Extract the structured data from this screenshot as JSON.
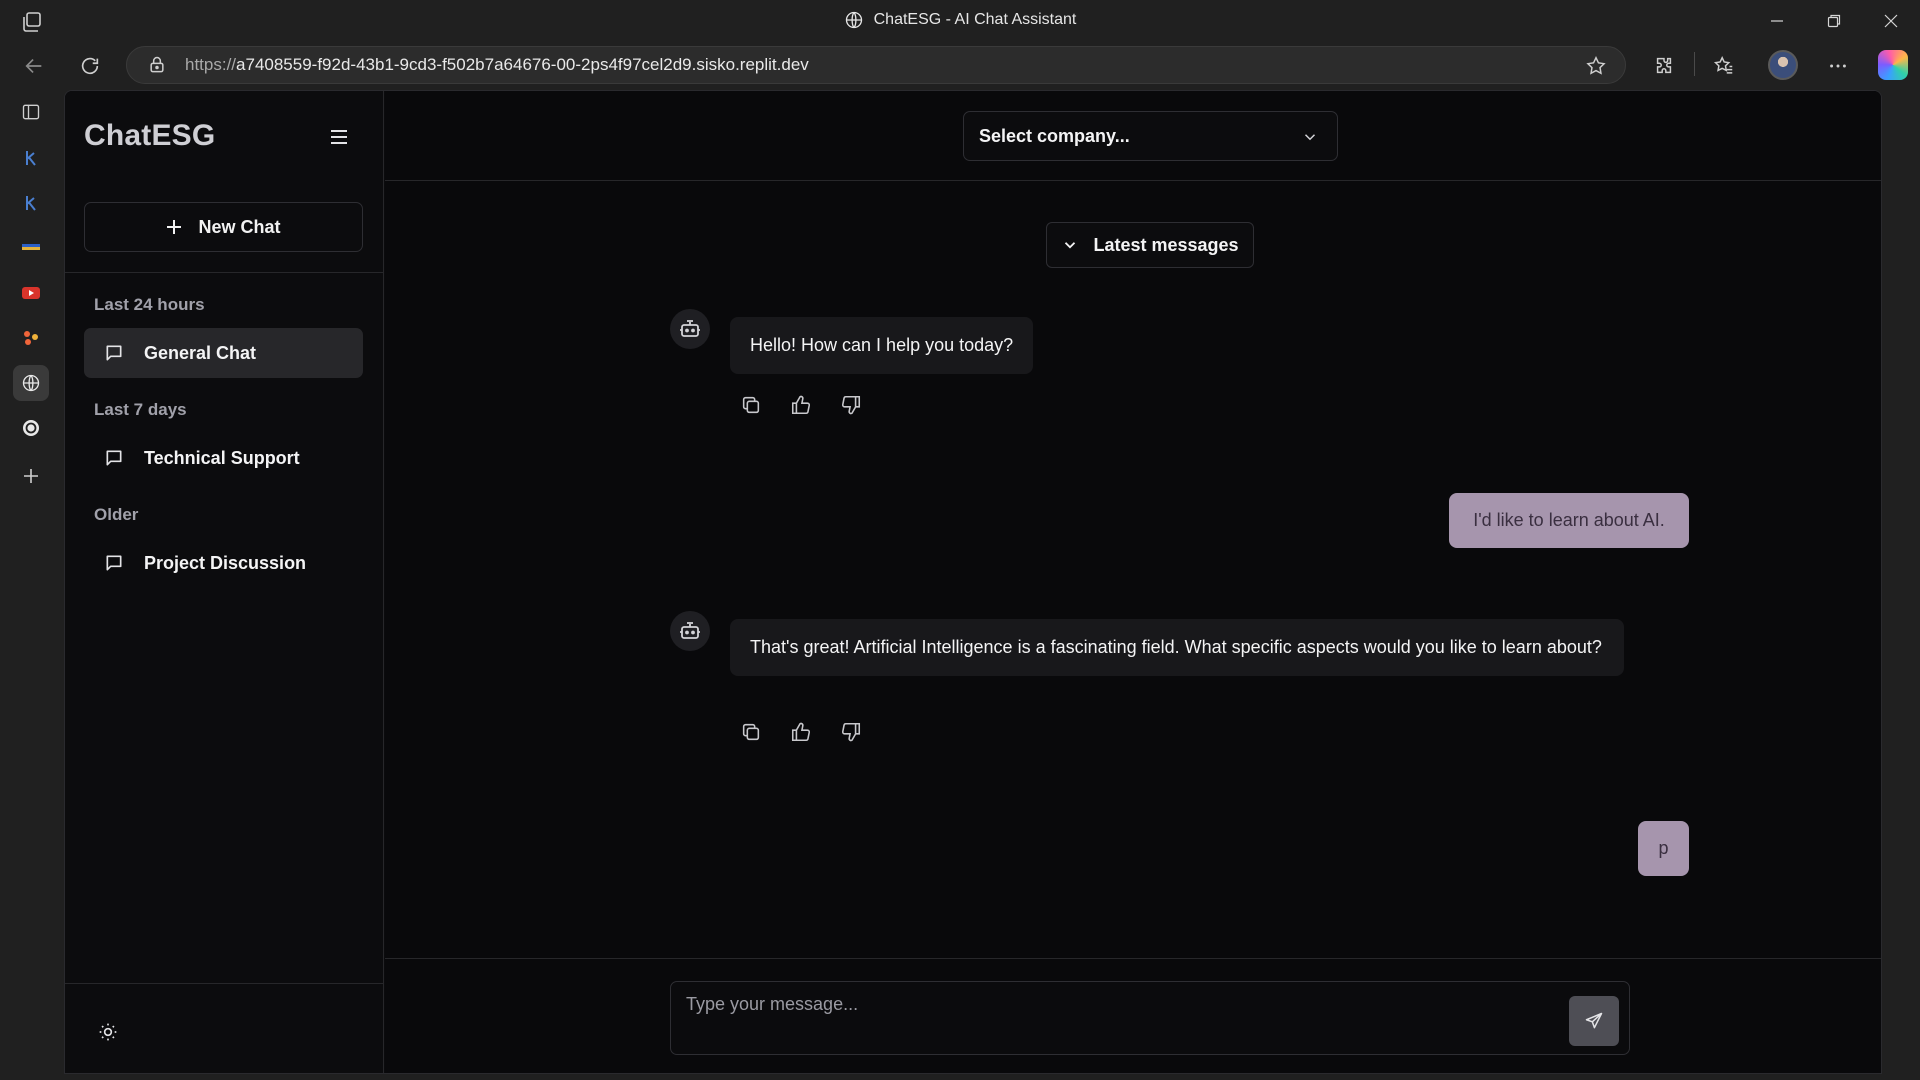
{
  "browser": {
    "window_title": "ChatESG - AI Chat Assistant",
    "url_scheme": "https://",
    "url_rest": "a7408559-f92d-43b1-9cd3-f502b7a64676-00-2ps4f97cel2d9.sisko.replit.dev"
  },
  "app": {
    "brand": "ChatESG",
    "new_chat_label": "New Chat",
    "groups": [
      {
        "label": "Last 24 hours",
        "chats": [
          "General Chat"
        ]
      },
      {
        "label": "Last 7 days",
        "chats": [
          "Technical Support"
        ]
      },
      {
        "label": "Older",
        "chats": [
          "Project Discussion"
        ]
      }
    ],
    "company_select_placeholder": "Select company...",
    "latest_messages_label": "Latest messages",
    "messages": [
      {
        "role": "assistant",
        "text": "Hello! How can I help you today?"
      },
      {
        "role": "user",
        "text": "I'd like to learn about AI."
      },
      {
        "role": "assistant",
        "text": "That's great! Artificial Intelligence is a fascinating field. What specific aspects would you like to learn about?"
      },
      {
        "role": "user",
        "text": "p"
      }
    ],
    "composer_placeholder": "Type your message..."
  },
  "colors": {
    "user_bubble": "#a695ad",
    "assistant_bubble": "#18181b",
    "background": "#09090b"
  }
}
